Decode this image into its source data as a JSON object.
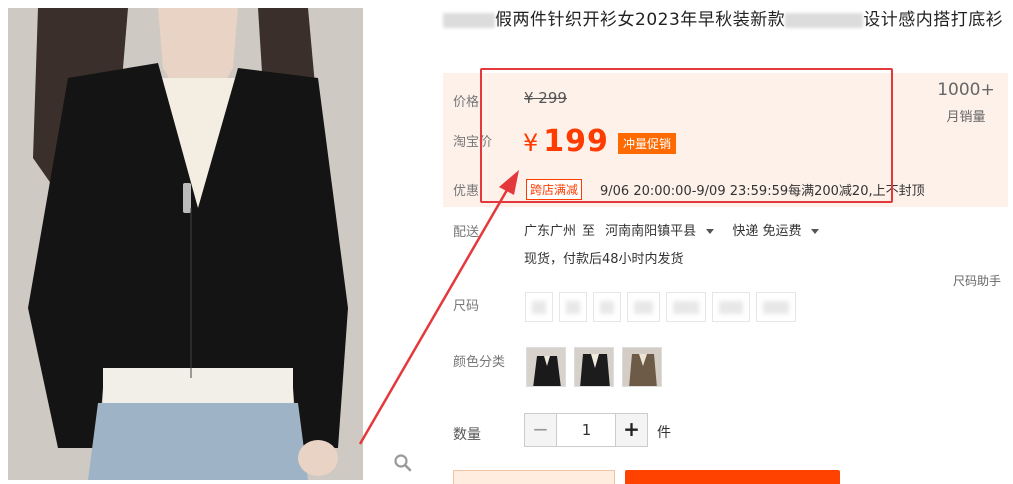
{
  "product": {
    "title_part1": "假两件针织开衫女2023年早秋装新款",
    "title_part2": "设计感内搭打底衫"
  },
  "price": {
    "price_label": "价格",
    "original": "¥ 299",
    "promo_label": "淘宝价",
    "currency": "¥",
    "promo": "199",
    "promo_tag": "冲量促销",
    "sales_count": "1000+",
    "sales_label": "月销量",
    "discount_label": "优惠",
    "discount_tag": "跨店满减",
    "discount_text": "9/06 20:00:00-9/09 23:59:59每满200减20,上不封顶"
  },
  "shipping": {
    "label": "配送",
    "from": "广东广州",
    "to_word": "至",
    "destination": "河南南阳镇平县",
    "method": "快递 免运费",
    "stock": "现货，付款后48小时内发货"
  },
  "size": {
    "label": "尺码",
    "helper": "尺码助手"
  },
  "color": {
    "label": "颜色分类"
  },
  "quantity": {
    "label": "数量",
    "minus": "−",
    "value": "1",
    "plus": "+",
    "unit": "件"
  },
  "colors": {
    "accent": "#ff3c00",
    "highlight_box": "#e4393c",
    "panel_bg": "#fdf1ea",
    "promo_tag": "#ff6a00"
  }
}
